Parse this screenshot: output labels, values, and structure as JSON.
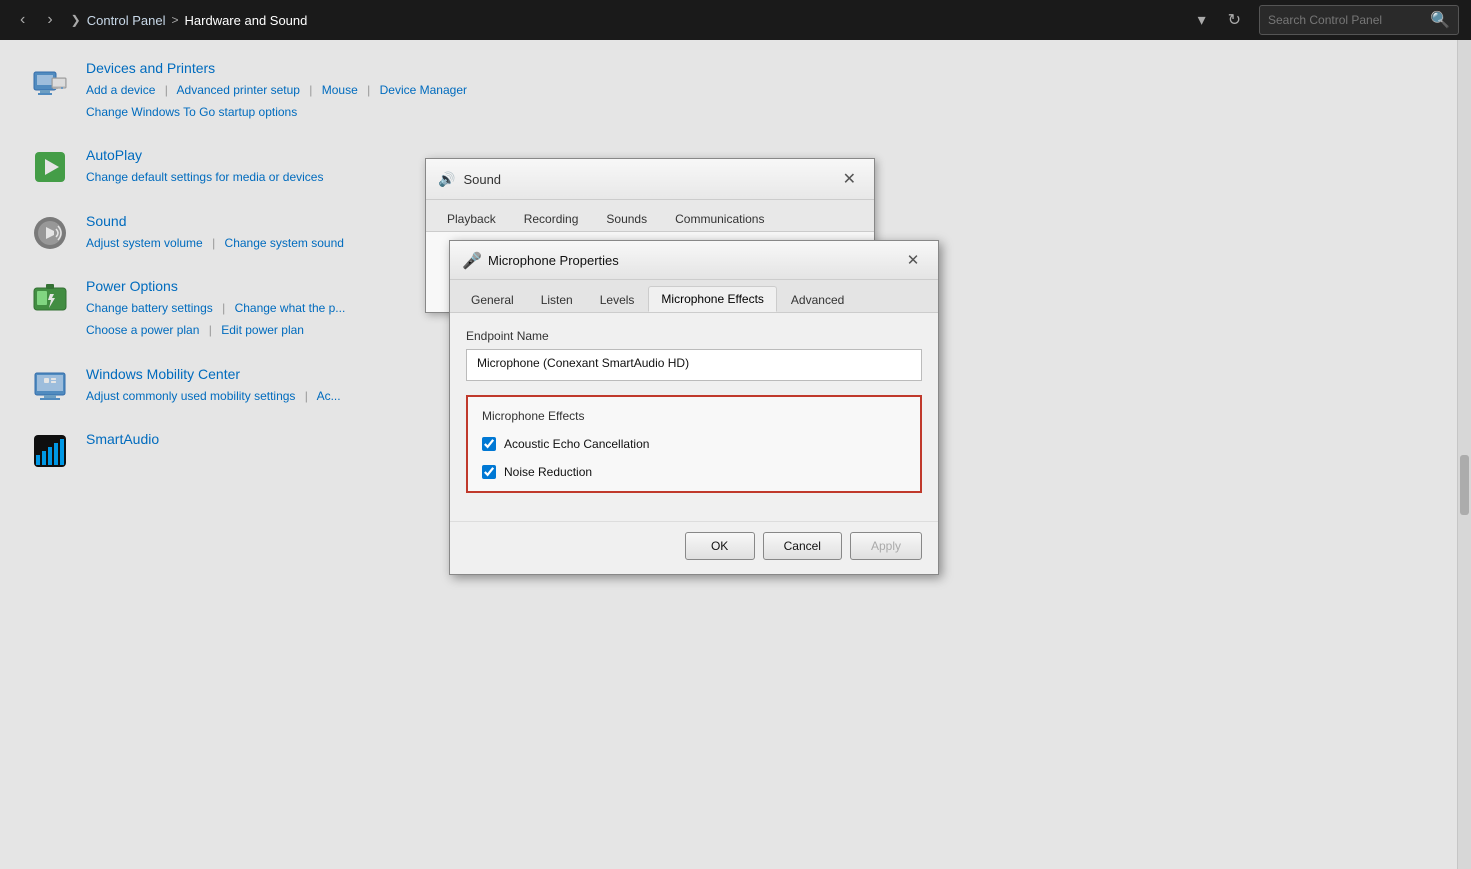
{
  "titlebar": {
    "breadcrumbs": [
      {
        "label": "Control Panel",
        "key": "control-panel"
      },
      {
        "label": "Hardware and Sound",
        "key": "hardware-sound"
      }
    ],
    "search_placeholder": "Search Control Panel",
    "dropdown_btn": "▾",
    "refresh_btn": "↺"
  },
  "cp_sections": [
    {
      "id": "devices-printers",
      "title": "Devices and Printers",
      "icon_type": "printer",
      "links": [
        {
          "label": "Add a device"
        },
        {
          "label": "Advanced printer setup"
        },
        {
          "label": "Mouse"
        },
        {
          "label": "Device Manager"
        },
        {
          "label": "Change Windows To Go startup options"
        }
      ]
    },
    {
      "id": "autoplay",
      "title": "AutoPlay",
      "icon_type": "autoplay",
      "links": [
        {
          "label": "Change default settings for media or devices"
        }
      ]
    },
    {
      "id": "sound",
      "title": "Sound",
      "icon_type": "sound",
      "links": [
        {
          "label": "Adjust system volume"
        },
        {
          "label": "Change system sound"
        }
      ]
    },
    {
      "id": "power-options",
      "title": "Power Options",
      "icon_type": "power",
      "links": [
        {
          "label": "Change battery settings"
        },
        {
          "label": "Change what the p..."
        },
        {
          "label": "Choose a power plan"
        },
        {
          "label": "Edit power plan"
        }
      ]
    },
    {
      "id": "mobility-center",
      "title": "Windows Mobility Center",
      "icon_type": "mobility",
      "links": [
        {
          "label": "Adjust commonly used mobility settings"
        },
        {
          "label": "Ac..."
        }
      ]
    },
    {
      "id": "smartaudio",
      "title": "SmartAudio",
      "icon_type": "smartaudio",
      "links": []
    }
  ],
  "sound_dialog": {
    "title": "Sound",
    "close_btn": "✕",
    "tabs": [
      "Playback",
      "Recording",
      "Sounds",
      "Communications"
    ]
  },
  "mic_dialog": {
    "title": "Microphone Properties",
    "close_btn": "✕",
    "tabs": [
      "General",
      "Listen",
      "Levels",
      "Microphone Effects",
      "Advanced"
    ],
    "active_tab": "Microphone Effects",
    "endpoint_label": "Endpoint Name",
    "endpoint_value": "Microphone (Conexant SmartAudio HD)",
    "effects_section_title": "Microphone Effects",
    "effects": [
      {
        "label": "Acoustic Echo Cancellation",
        "checked": true
      },
      {
        "label": "Noise Reduction",
        "checked": true
      }
    ],
    "buttons": {
      "ok": "OK",
      "cancel": "Cancel",
      "apply": "Apply"
    }
  }
}
